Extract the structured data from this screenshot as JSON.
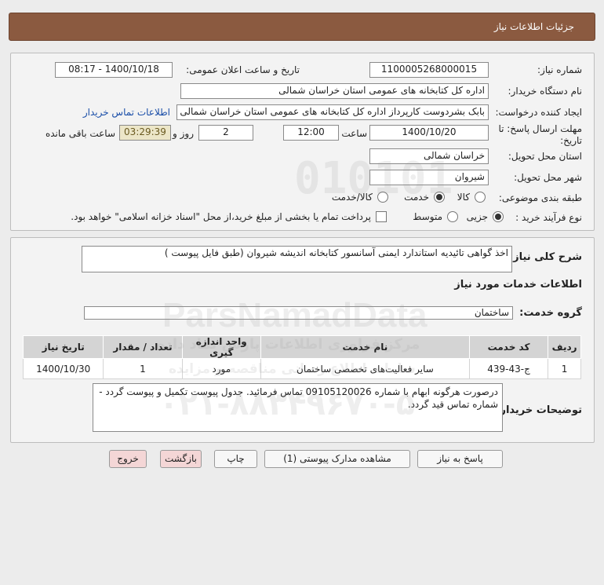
{
  "header": {
    "title": "جزئیات اطلاعات نیاز"
  },
  "fields": {
    "need_number_label": "شماره نیاز:",
    "need_number": "1100005268000015",
    "announce_label": "تاریخ و ساعت اعلان عمومی:",
    "announce_value": "1400/10/18 - 08:17",
    "buyer_org_label": "نام دستگاه خریدار:",
    "buyer_org": "اداره کل کتابخانه های عمومی استان خراسان شمالی",
    "requester_label": "ایجاد کننده درخواست:",
    "requester": "بابک  بشردوست کارپرداز  اداره کل کتابخانه های عمومی استان خراسان شمالی",
    "contact_link": "اطلاعات تماس خریدار",
    "deadline_label": "مهلت ارسال پاسخ: تا تاریخ:",
    "deadline_date": "1400/10/20",
    "time_label": "ساعت",
    "deadline_time": "12:00",
    "days": "2",
    "days_label": "روز و",
    "remaining": "03:29:39",
    "remaining_label": "ساعت باقی مانده",
    "province_label": "استان محل تحویل:",
    "province": "خراسان شمالی",
    "city_label": "شهر محل تحویل:",
    "city": "شیروان",
    "category_label": "طبقه بندی موضوعی:",
    "category_options": [
      "کالا",
      "خدمت",
      "کالا/خدمت"
    ],
    "category_selected": 1,
    "purchase_type_label": "نوع فرآیند خرید :",
    "purchase_options": [
      "جزیی",
      "متوسط"
    ],
    "purchase_selected": 0,
    "payment_note": "پرداخت تمام یا بخشی از مبلغ خرید،از محل \"اسناد خزانه اسلامی\" خواهد بود."
  },
  "summary": {
    "description_label": "شرح کلی نیاز:",
    "description": "اخذ گواهی تائیدیه استاندارد ایمنی آسانسور کتابخانه اندیشه شیروان (طبق فایل پیوست )",
    "services_heading": "اطلاعات خدمات مورد نیاز",
    "service_group_label": "گروه خدمت:",
    "service_group": "ساختمان",
    "table_headers": [
      "ردیف",
      "کد خدمت",
      "نام خدمت",
      "واحد اندازه گیری",
      "تعداد / مقدار",
      "تاریخ نیاز"
    ],
    "table_rows": [
      [
        "1",
        "ج-43-439",
        "سایر فعالیت‌های تخصصی ساختمان",
        "مورد",
        "1",
        "1400/10/30"
      ]
    ],
    "buyer_notes_label": "توضیحات خریدار:",
    "buyer_notes": "درصورت هرگونه ابهام با شماره 09105120026 تماس فرمائید. جدول پیوست تکمیل و پیوست گردد - شماره تماس قید گردد."
  },
  "buttons": {
    "reply": "پاسخ به نیاز",
    "attachments": "مشاهده مدارک پیوستی (1)",
    "print": "چاپ",
    "back": "بازگشت",
    "exit": "خروج"
  },
  "watermark": {
    "brand": "ParsNamadData",
    "number": "010101",
    "persian": "مرکز فراوری اطلاعات پارس نماد داده",
    "sub": "سامانه اطلاع رسانی مناقصه و مزایده",
    "phone": "۰۲۱-۸۸۳۴۹۶۷۰-۵"
  },
  "colors": {
    "header_bg": "#8b5a40",
    "link": "#1a4ea8",
    "remaining_bg": "#ece6c8"
  }
}
